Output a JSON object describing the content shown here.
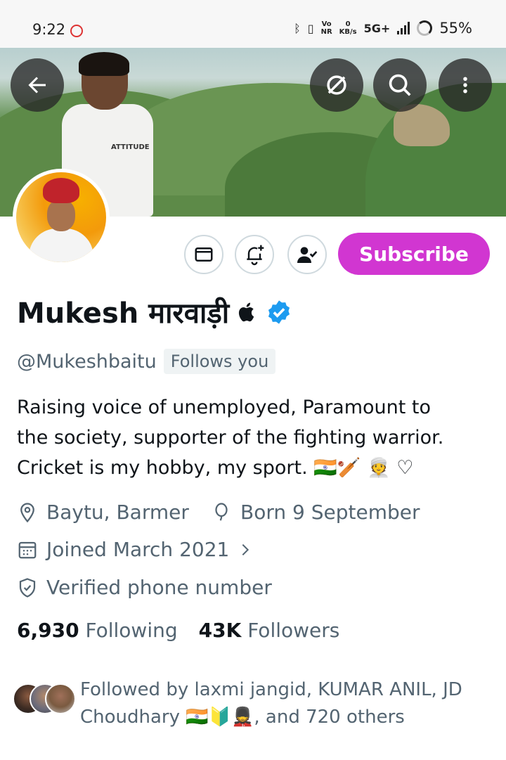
{
  "status_bar": {
    "time": "9:22",
    "vo_nr": "Vo\nNR",
    "kbs_value": "0",
    "kbs_unit": "KB/s",
    "network": "5G+",
    "battery": "55%"
  },
  "profile": {
    "name": "Mukesh मारवाड़ी",
    "handle": "@Mukeshbaitu",
    "follows_you": "Follows you",
    "bio_lines": [
      "Raising voice of unemployed, Paramount to",
      "the society, supporter of the fighting warrior.",
      "Cricket is my hobby, my sport. 🇮🇳🏏 👳 ♡"
    ],
    "location": "Baytu, Barmer",
    "birthday": "Born 9 September",
    "joined": "Joined March 2021",
    "verified_phone": "Verified phone number",
    "following_count": "6,930",
    "following_label": "Following",
    "followers_count": "43K",
    "followers_label": "Followers",
    "followed_by_lines": [
      "Followed by laxmi jangid, KUMAR ANIL, JD",
      "Choudhary 🇮🇳🔰💂, and 720 others"
    ]
  },
  "actions": {
    "subscribe_label": "Subscribe"
  },
  "banner": {
    "shirt_text": "ATTITUDE"
  },
  "colors": {
    "subscribe": "#d136d1",
    "verified": "#1d9bf0",
    "secondary_text": "#536471"
  }
}
